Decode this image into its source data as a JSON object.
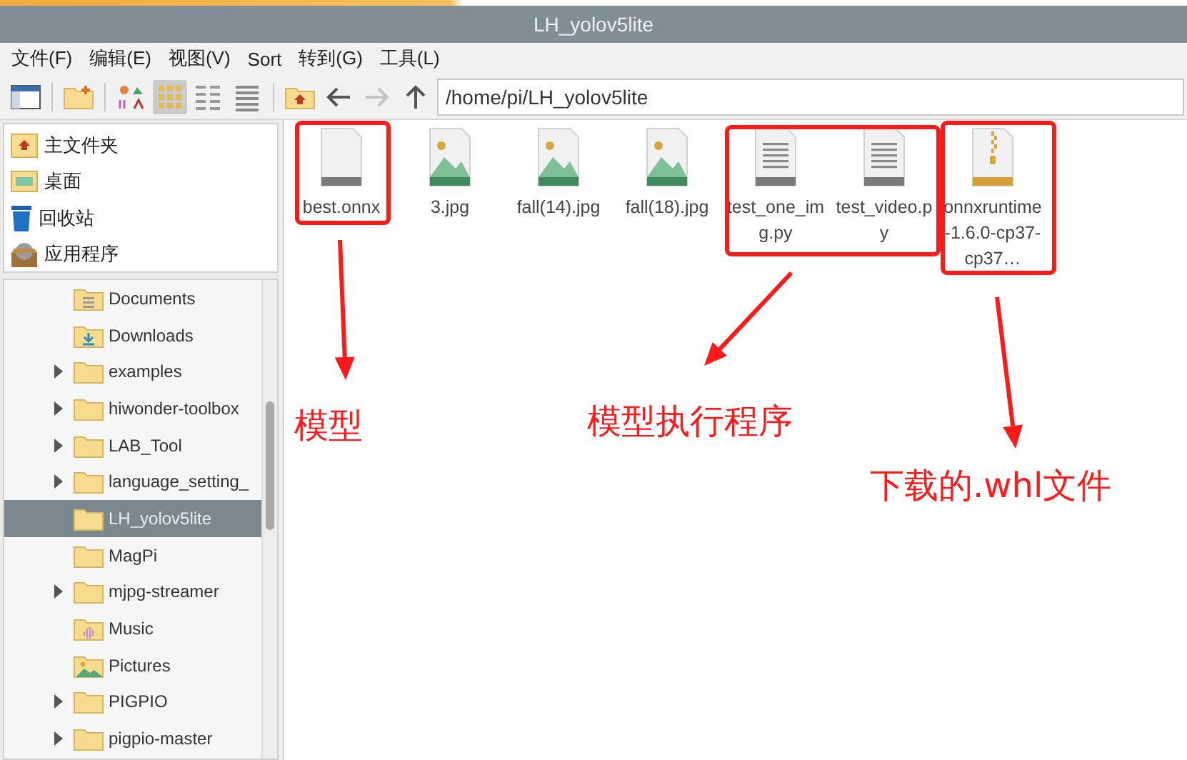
{
  "window": {
    "title": "LH_yolov5lite"
  },
  "menu": [
    "文件(F)",
    "编辑(E)",
    "视图(V)",
    "Sort",
    "转到(G)",
    "工具(L)"
  ],
  "toolbar": {
    "view_buttons": [
      {
        "kind": "icons",
        "selected": true
      },
      {
        "kind": "compact",
        "selected": false
      },
      {
        "kind": "list",
        "selected": false
      }
    ],
    "forward_disabled": true,
    "path": "/home/pi/LH_yolov5lite"
  },
  "places": [
    {
      "label": "主文件夹",
      "kind": "home"
    },
    {
      "label": "桌面",
      "kind": "desktop"
    },
    {
      "label": "回收站",
      "kind": "trash"
    },
    {
      "label": "应用程序",
      "kind": "apps"
    }
  ],
  "tree": [
    {
      "label": "Documents",
      "kind": "documents",
      "expandable": false,
      "selected": false
    },
    {
      "label": "Downloads",
      "kind": "downloads",
      "expandable": false,
      "selected": false
    },
    {
      "label": "examples",
      "kind": "folder",
      "expandable": true,
      "selected": false
    },
    {
      "label": "hiwonder-toolbox",
      "kind": "folder",
      "expandable": true,
      "selected": false
    },
    {
      "label": "LAB_Tool",
      "kind": "folder",
      "expandable": true,
      "selected": false
    },
    {
      "label": "language_setting_",
      "kind": "folder",
      "expandable": true,
      "selected": false
    },
    {
      "label": "LH_yolov5lite",
      "kind": "folder",
      "expandable": false,
      "selected": true
    },
    {
      "label": "MagPi",
      "kind": "folder",
      "expandable": false,
      "selected": false
    },
    {
      "label": "mjpg-streamer",
      "kind": "folder",
      "expandable": true,
      "selected": false
    },
    {
      "label": "Music",
      "kind": "music",
      "expandable": false,
      "selected": false
    },
    {
      "label": "Pictures",
      "kind": "pictures",
      "expandable": false,
      "selected": false
    },
    {
      "label": "PIGPIO",
      "kind": "folder",
      "expandable": true,
      "selected": false
    },
    {
      "label": "pigpio-master",
      "kind": "folder",
      "expandable": true,
      "selected": false
    }
  ],
  "files": [
    {
      "name": "best.onnx",
      "kind": "blank"
    },
    {
      "name": "3.jpg",
      "kind": "image"
    },
    {
      "name": "fall(14).jpg",
      "kind": "image"
    },
    {
      "name": "fall(18).jpg",
      "kind": "image"
    },
    {
      "name": "test_one_img.py",
      "kind": "text"
    },
    {
      "name": "test_video.py",
      "kind": "text"
    },
    {
      "name": "onnxruntime-1.6.0-cp37-cp37…",
      "kind": "archive"
    }
  ],
  "annotations": [
    "模型",
    "模型执行程序",
    "下载的.whl文件"
  ]
}
